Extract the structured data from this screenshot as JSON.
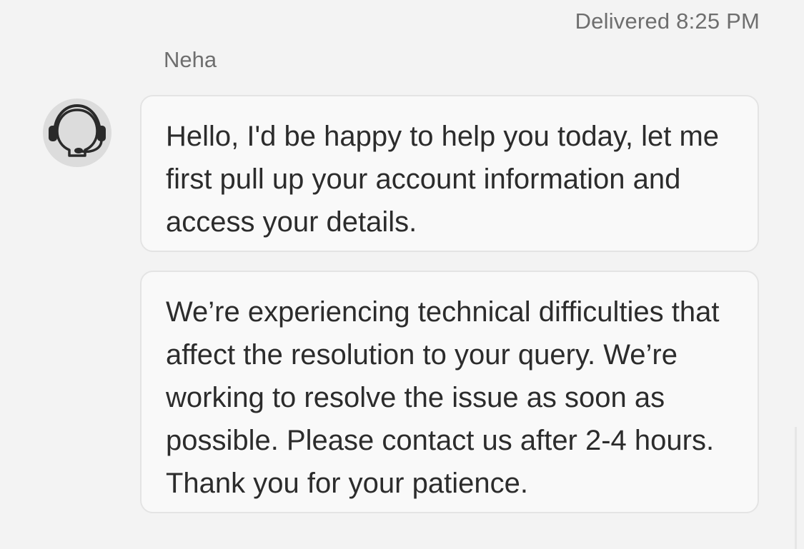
{
  "status": {
    "delivered": "Delivered 8:25 PM"
  },
  "agent": {
    "name": "Neha",
    "avatar_icon": "headset-agent-icon"
  },
  "messages": [
    {
      "text": "Hello, I'd be happy to help you today, let me first pull up your account information and access your details."
    },
    {
      "text": "We’re experiencing technical difficulties that affect the resolution to your query. We’re working to resolve the issue as soon as possible. Please contact us after 2-4 hours. Thank you for your patience."
    }
  ],
  "colors": {
    "background": "#f3f3f3",
    "bubble": "#f9f9f9",
    "bubble_border": "#e4e4e4",
    "avatar_bg": "#dcdcdc",
    "meta_text": "#6e6e6e",
    "message_text": "#2c2c2c"
  }
}
